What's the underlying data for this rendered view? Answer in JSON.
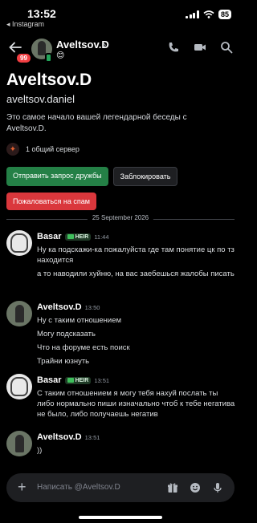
{
  "status": {
    "time": "13:52",
    "back_app": "◂ Instagram",
    "battery": "85"
  },
  "header": {
    "name": "Aveltsov.D",
    "chevron": "›",
    "badge": "99",
    "status_emoji": "😊"
  },
  "profile": {
    "display_name": "Aveltsov.D",
    "username": "aveltsov.daniel",
    "intro": "Это самое начало вашей легендарной беседы с Aveltsov.D.",
    "mutual_servers": "1 общий сервер",
    "buttons": {
      "friend_request": "Отправить запрос дружбы",
      "block": "Заблокировать",
      "report": "Пожаловаться на спам"
    }
  },
  "date_divider": "25 September 2026",
  "messages": [
    {
      "author": "Basar",
      "tag": "HEIR",
      "time": "11:44",
      "lines": [
        "Ну ка подскажи-ка пожалуйста где там  понятие цк по тз находится",
        "а то наводили хуйню, на вас заебешься жалобы писать"
      ]
    },
    {
      "author": "Aveltsov.D",
      "time": "13:50",
      "lines": [
        "Ну с таким отношением",
        "Могу подсказать",
        "Что на форуме есть поиск",
        "Трайни юзнуть"
      ]
    },
    {
      "author": "Basar",
      "tag": "HEIR",
      "time": "13:51",
      "lines": [
        "С таким отношением я могу тебя нахуй послать ты либо нормально пиши изначально чтоб к тебе негатива не было, либо получаешь негатив"
      ]
    },
    {
      "author": "Aveltsov.D",
      "time": "13:51",
      "lines": [
        "))"
      ]
    }
  ],
  "input": {
    "placeholder": "Написать @Aveltsov.D"
  },
  "colors": {
    "accent_green": "#248046",
    "danger_red": "#da373c",
    "background": "#000000"
  }
}
